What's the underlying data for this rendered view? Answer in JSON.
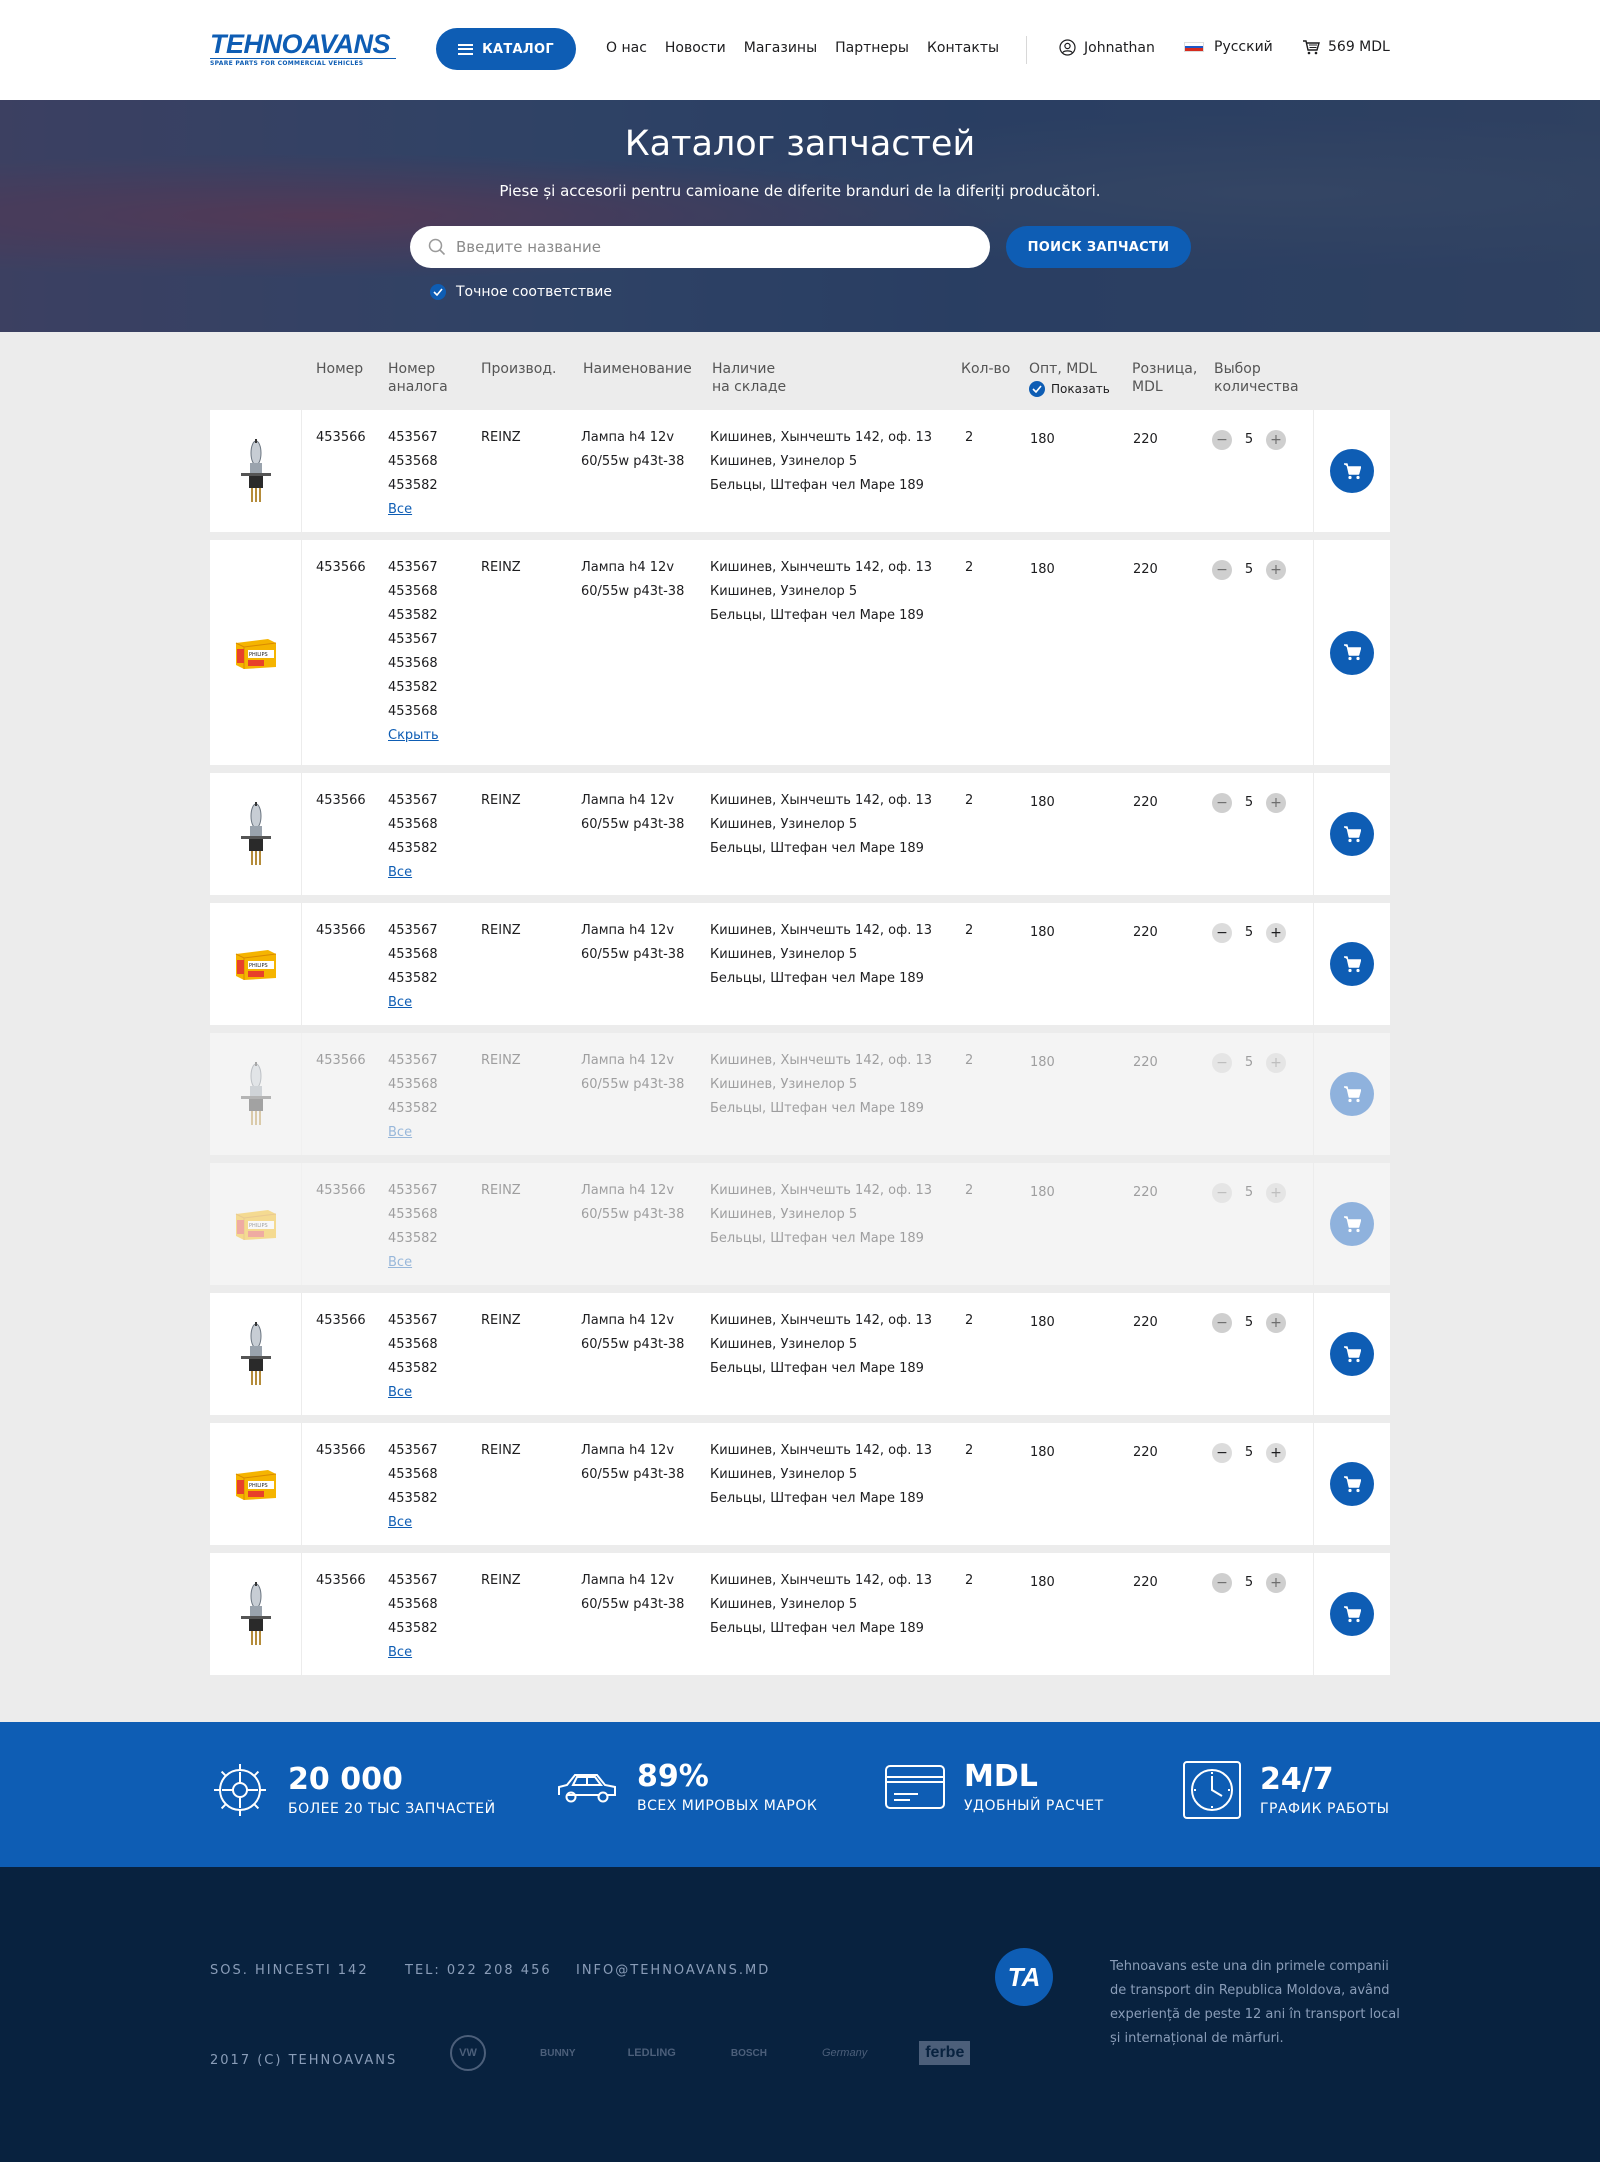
{
  "header": {
    "logo_text": "TEHNOAVANS",
    "logo_sub": "SPARE PARTS FOR COMMERCIAL VEHICLES",
    "catalog_label": "КАТАЛОГ",
    "nav": [
      "О нас",
      "Новости",
      "Магазины",
      "Партнеры",
      "Контакты"
    ],
    "user": "Johnathan",
    "language": "Русский",
    "cart_total": "569 MDL"
  },
  "hero": {
    "title": "Каталог запчастей",
    "subtitle": "Piese și accesorii pentru camioane de diferite branduri de la diferiți producători.",
    "search_placeholder": "Введите название",
    "search_button": "ПОИСК ЗАПЧАСТИ",
    "exact_match": "Точное соответствие"
  },
  "table": {
    "headers": {
      "number": "Номер",
      "analog_1": "Номер",
      "analog_2": "аналога",
      "manufacturer": "Производ.",
      "name": "Наименование",
      "stock_1": "Наличие",
      "stock_2": "на складе",
      "qty": "Кол-во",
      "opt": "Опт, MDL",
      "show": "Показать",
      "retail_1": "Розница,",
      "retail_2": "MDL",
      "select_1": "Выбор",
      "select_2": "количества"
    },
    "rows": [
      {
        "image": "bulb",
        "number": "453566",
        "analogs": [
          "453567",
          "453568",
          "453582"
        ],
        "link": "Все",
        "manufacturer": "REINZ",
        "name": [
          "Лампа h4 12v",
          "60/55w p43t-38"
        ],
        "stock": [
          "Кишинев, Хынчешть 142, оф. 13",
          "Кишинев, Узинелор 5",
          "Бельцы, Штефан чел Маре 189"
        ],
        "qty": "2",
        "opt": "180",
        "retail": "220",
        "selected": "5",
        "faded": false
      },
      {
        "image": "box",
        "number": "453566",
        "analogs": [
          "453567",
          "453568",
          "453582",
          "453567",
          "453568",
          "453582",
          "453568"
        ],
        "link": "Скрыть",
        "manufacturer": "REINZ",
        "name": [
          "Лампа h4 12v",
          "60/55w p43t-38"
        ],
        "stock": [
          "Кишинев, Хынчешть 142, оф. 13",
          "Кишинев, Узинелор 5",
          "Бельцы, Штефан чел Маре 189"
        ],
        "qty": "2",
        "opt": "180",
        "retail": "220",
        "selected": "5",
        "faded": false
      },
      {
        "image": "bulb",
        "number": "453566",
        "analogs": [
          "453567",
          "453568",
          "453582"
        ],
        "link": "Все",
        "manufacturer": "REINZ",
        "name": [
          "Лампа h4 12v",
          "60/55w p43t-38"
        ],
        "stock": [
          "Кишинев, Хынчешть 142, оф. 13",
          "Кишинев, Узинелор 5",
          "Бельцы, Штефан чел Маре 189"
        ],
        "qty": "2",
        "opt": "180",
        "retail": "220",
        "selected": "5",
        "faded": false
      },
      {
        "image": "box",
        "number": "453566",
        "analogs": [
          "453567",
          "453568",
          "453582"
        ],
        "link": "Все",
        "manufacturer": "REINZ",
        "name": [
          "Лампа h4 12v",
          "60/55w p43t-38"
        ],
        "stock": [
          "Кишинев, Хынчешть 142, оф. 13",
          "Кишинев, Узинелор 5",
          "Бельцы, Штефан чел Маре 189"
        ],
        "qty": "2",
        "opt": "180",
        "retail": "220",
        "selected": "5",
        "faded": false
      },
      {
        "image": "bulb",
        "number": "453566",
        "analogs": [
          "453567",
          "453568",
          "453582"
        ],
        "link": "Все",
        "manufacturer": "REINZ",
        "name": [
          "Лампа h4 12v",
          "60/55w p43t-38"
        ],
        "stock": [
          "Кишинев, Хынчешть 142, оф. 13",
          "Кишинев, Узинелор 5",
          "Бельцы, Штефан чел Маре 189"
        ],
        "qty": "2",
        "opt": "180",
        "retail": "220",
        "selected": "5",
        "faded": true
      },
      {
        "image": "box",
        "number": "453566",
        "analogs": [
          "453567",
          "453568",
          "453582"
        ],
        "link": "Все",
        "manufacturer": "REINZ",
        "name": [
          "Лампа h4 12v",
          "60/55w p43t-38"
        ],
        "stock": [
          "Кишинев, Хынчешть 142, оф. 13",
          "Кишинев, Узинелор 5",
          "Бельцы, Штефан чел Маре 189"
        ],
        "qty": "2",
        "opt": "180",
        "retail": "220",
        "selected": "5",
        "faded": true
      },
      {
        "image": "bulb",
        "number": "453566",
        "analogs": [
          "453567",
          "453568",
          "453582"
        ],
        "link": "Все",
        "manufacturer": "REINZ",
        "name": [
          "Лампа h4 12v",
          "60/55w p43t-38"
        ],
        "stock": [
          "Кишинев, Хынчешть 142, оф. 13",
          "Кишинев, Узинелор 5",
          "Бельцы, Штефан чел Маре 189"
        ],
        "qty": "2",
        "opt": "180",
        "retail": "220",
        "selected": "5",
        "faded": false
      },
      {
        "image": "box",
        "number": "453566",
        "analogs": [
          "453567",
          "453568",
          "453582"
        ],
        "link": "Все",
        "manufacturer": "REINZ",
        "name": [
          "Лампа h4 12v",
          "60/55w p43t-38"
        ],
        "stock": [
          "Кишинев, Хынчешть 142, оф. 13",
          "Кишинев, Узинелор 5",
          "Бельцы, Штефан чел Маре 189"
        ],
        "qty": "2",
        "opt": "180",
        "retail": "220",
        "selected": "5",
        "faded": false
      },
      {
        "image": "bulb",
        "number": "453566",
        "analogs": [
          "453567",
          "453568",
          "453582"
        ],
        "link": "Все",
        "manufacturer": "REINZ",
        "name": [
          "Лампа h4 12v",
          "60/55w p43t-38"
        ],
        "stock": [
          "Кишинев, Хынчешть 142, оф. 13",
          "Кишинев, Узинелор 5",
          "Бельцы, Штефан чел Маре 189"
        ],
        "qty": "2",
        "opt": "180",
        "retail": "220",
        "selected": "5",
        "faded": false
      }
    ]
  },
  "stats": [
    {
      "icon": "gear-icon",
      "value": "20 000",
      "label": "БОЛЕЕ 20 ТЫС ЗАПЧАСТЕЙ"
    },
    {
      "icon": "car-icon",
      "value": "89%",
      "label": "ВСЕХ МИРОВЫХ МАРОК"
    },
    {
      "icon": "card-icon",
      "value": "MDL",
      "label": "УДОБНЫЙ РАСЧЕТ"
    },
    {
      "icon": "clock-icon",
      "value": "24/7",
      "label": "ГРАФИК РАБОТЫ"
    }
  ],
  "footer": {
    "address": "SOS. HINCESTI 142",
    "phone": "TEL: 022 208 456",
    "email": "INFO@TEHNOAVANS.MD",
    "copyright": "2017 (C) TEHNOAVANS",
    "logo": "TA",
    "about": "Tehnoavans este una din primele companii de transport din Republica Moldova, având experiență de peste 12 ani în transport local și internațional de mărfuri.",
    "brands": [
      "VW",
      "BUNNY",
      "LEDLING",
      "BOSCH",
      "Germany",
      "ferbe"
    ]
  },
  "colors": {
    "accent": "#0e5db4",
    "footer_bg": "#08223f",
    "page_bg": "#ececec"
  }
}
